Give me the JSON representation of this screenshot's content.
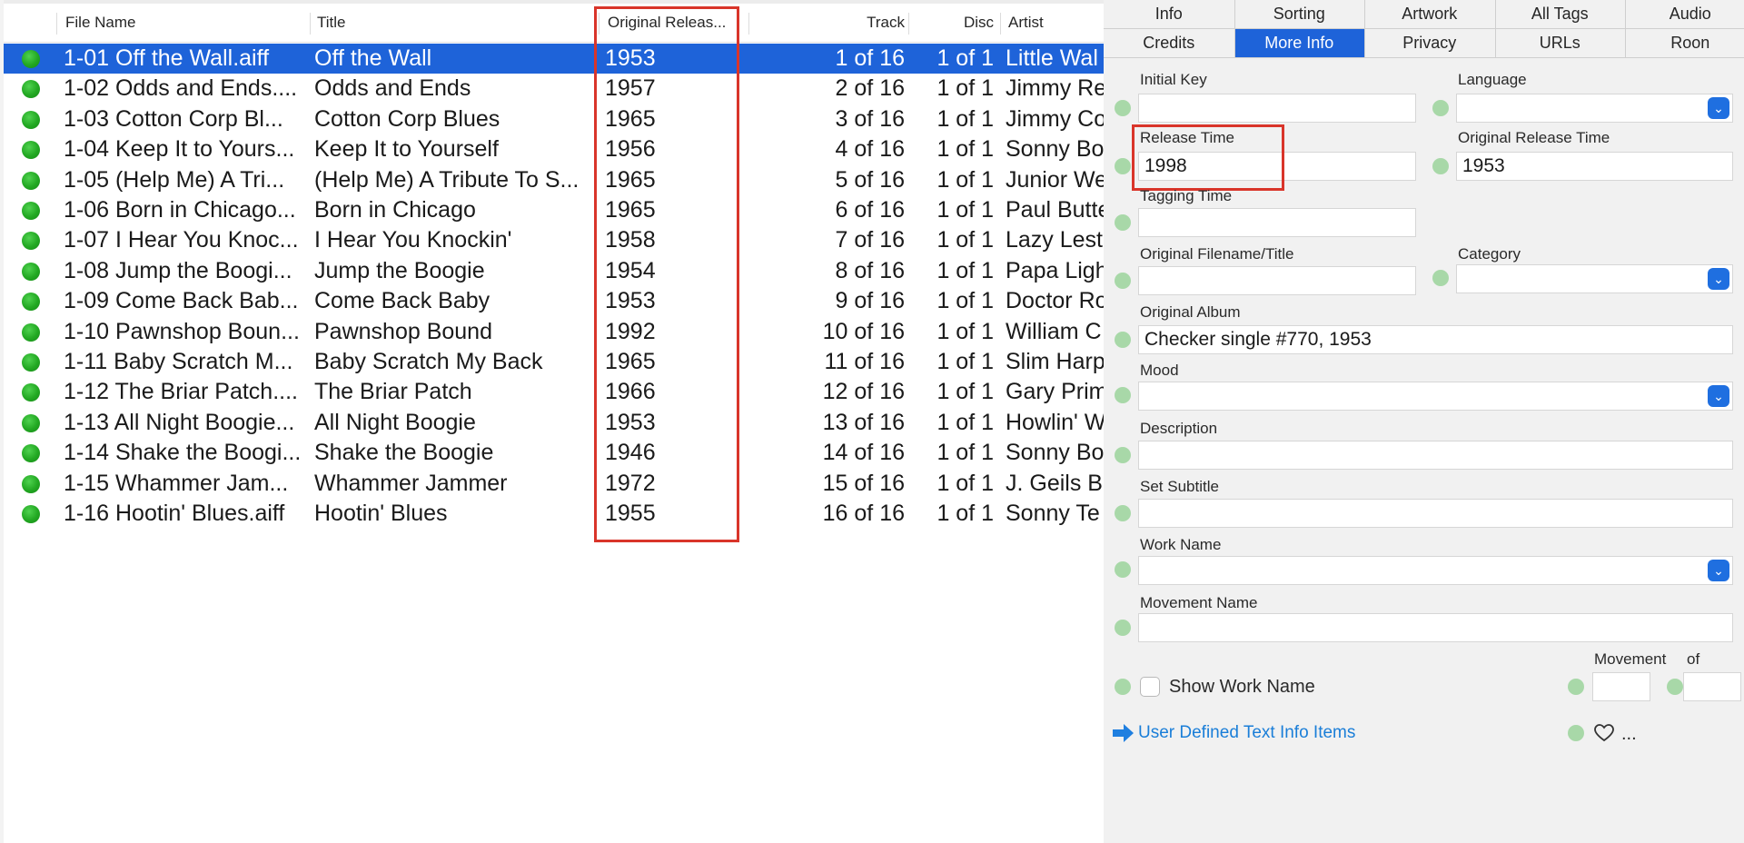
{
  "table": {
    "headers": {
      "file_name": "File Name",
      "title": "Title",
      "original_release": "Original Releas...",
      "track": "Track",
      "disc": "Disc",
      "artist": "Artist"
    },
    "rows": [
      {
        "file": "1-01 Off the Wall.aiff",
        "title": "Off the Wall",
        "year": "1953",
        "track": "1 of 16",
        "disc": "1 of 1",
        "artist": "Little Wal"
      },
      {
        "file": "1-02 Odds and Ends....",
        "title": "Odds and Ends",
        "year": "1957",
        "track": "2 of 16",
        "disc": "1 of 1",
        "artist": "Jimmy Re"
      },
      {
        "file": "1-03 Cotton Corp Bl...",
        "title": "Cotton Corp Blues",
        "year": "1965",
        "track": "3 of 16",
        "disc": "1 of 1",
        "artist": "Jimmy Co"
      },
      {
        "file": "1-04 Keep It to Yours...",
        "title": "Keep It to Yourself",
        "year": "1956",
        "track": "4 of 16",
        "disc": "1 of 1",
        "artist": "Sonny Bo"
      },
      {
        "file": "1-05 (Help Me) A Tri...",
        "title": "(Help Me) A Tribute To S...",
        "year": "1965",
        "track": "5 of 16",
        "disc": "1 of 1",
        "artist": "Junior We"
      },
      {
        "file": "1-06 Born in Chicago...",
        "title": "Born in Chicago",
        "year": "1965",
        "track": "6 of 16",
        "disc": "1 of 1",
        "artist": "Paul Butte"
      },
      {
        "file": "1-07 I Hear You Knoc...",
        "title": "I Hear You Knockin'",
        "year": "1958",
        "track": "7 of 16",
        "disc": "1 of 1",
        "artist": "Lazy Lest"
      },
      {
        "file": "1-08 Jump the Boogi...",
        "title": "Jump the Boogie",
        "year": "1954",
        "track": "8 of 16",
        "disc": "1 of 1",
        "artist": "Papa Ligh"
      },
      {
        "file": "1-09 Come Back Bab...",
        "title": "Come Back Baby",
        "year": "1953",
        "track": "9 of 16",
        "disc": "1 of 1",
        "artist": "Doctor Ro"
      },
      {
        "file": "1-10 Pawnshop Boun...",
        "title": "Pawnshop Bound",
        "year": "1992",
        "track": "10 of 16",
        "disc": "1 of 1",
        "artist": "William C"
      },
      {
        "file": "1-11 Baby Scratch M...",
        "title": "Baby Scratch My Back",
        "year": "1965",
        "track": "11 of 16",
        "disc": "1 of 1",
        "artist": "Slim Harp"
      },
      {
        "file": "1-12 The Briar Patch....",
        "title": "The Briar Patch",
        "year": "1966",
        "track": "12 of 16",
        "disc": "1 of 1",
        "artist": "Gary Prim"
      },
      {
        "file": "1-13 All Night Boogie...",
        "title": "All Night Boogie",
        "year": "1953",
        "track": "13 of 16",
        "disc": "1 of 1",
        "artist": "Howlin' W"
      },
      {
        "file": "1-14 Shake the Boogi...",
        "title": "Shake the Boogie",
        "year": "1946",
        "track": "14 of 16",
        "disc": "1 of 1",
        "artist": "Sonny Bo"
      },
      {
        "file": "1-15 Whammer Jam...",
        "title": "Whammer Jammer",
        "year": "1972",
        "track": "15 of 16",
        "disc": "1 of 1",
        "artist": "J. Geils B"
      },
      {
        "file": "1-16 Hootin' Blues.aiff",
        "title": "Hootin' Blues",
        "year": "1955",
        "track": "16 of 16",
        "disc": "1 of 1",
        "artist": "Sonny Te"
      }
    ]
  },
  "tabs": {
    "row1": [
      "Info",
      "Sorting",
      "Artwork",
      "All Tags",
      "Audio"
    ],
    "row2": [
      "Credits",
      "More Info",
      "Privacy",
      "URLs",
      "Roon"
    ],
    "active": "More Info"
  },
  "form": {
    "initial_key": {
      "label": "Initial Key",
      "value": ""
    },
    "language": {
      "label": "Language",
      "value": ""
    },
    "release_time": {
      "label": "Release Time",
      "value": "1998"
    },
    "original_release_time": {
      "label": "Original Release Time",
      "value": "1953"
    },
    "tagging_time": {
      "label": "Tagging Time",
      "value": ""
    },
    "original_filename": {
      "label": "Original Filename/Title",
      "value": ""
    },
    "category": {
      "label": "Category",
      "value": ""
    },
    "original_album": {
      "label": "Original Album",
      "value": "Checker single #770, 1953"
    },
    "mood": {
      "label": "Mood",
      "value": ""
    },
    "description": {
      "label": "Description",
      "value": ""
    },
    "set_subtitle": {
      "label": "Set Subtitle",
      "value": ""
    },
    "work_name": {
      "label": "Work Name",
      "value": ""
    },
    "movement_name": {
      "label": "Movement Name",
      "value": ""
    },
    "movement": {
      "label": "Movement",
      "of_label": "of",
      "value": "",
      "of_value": ""
    },
    "show_work_name": {
      "label": "Show Work Name",
      "checked": false
    },
    "user_defined_link": "User Defined Text Info Items",
    "more_glyph": "..."
  },
  "colors": {
    "selection": "#1e63d9",
    "highlight_box": "#d9352a",
    "status_green": "#22a822",
    "link": "#1a7ed8"
  }
}
